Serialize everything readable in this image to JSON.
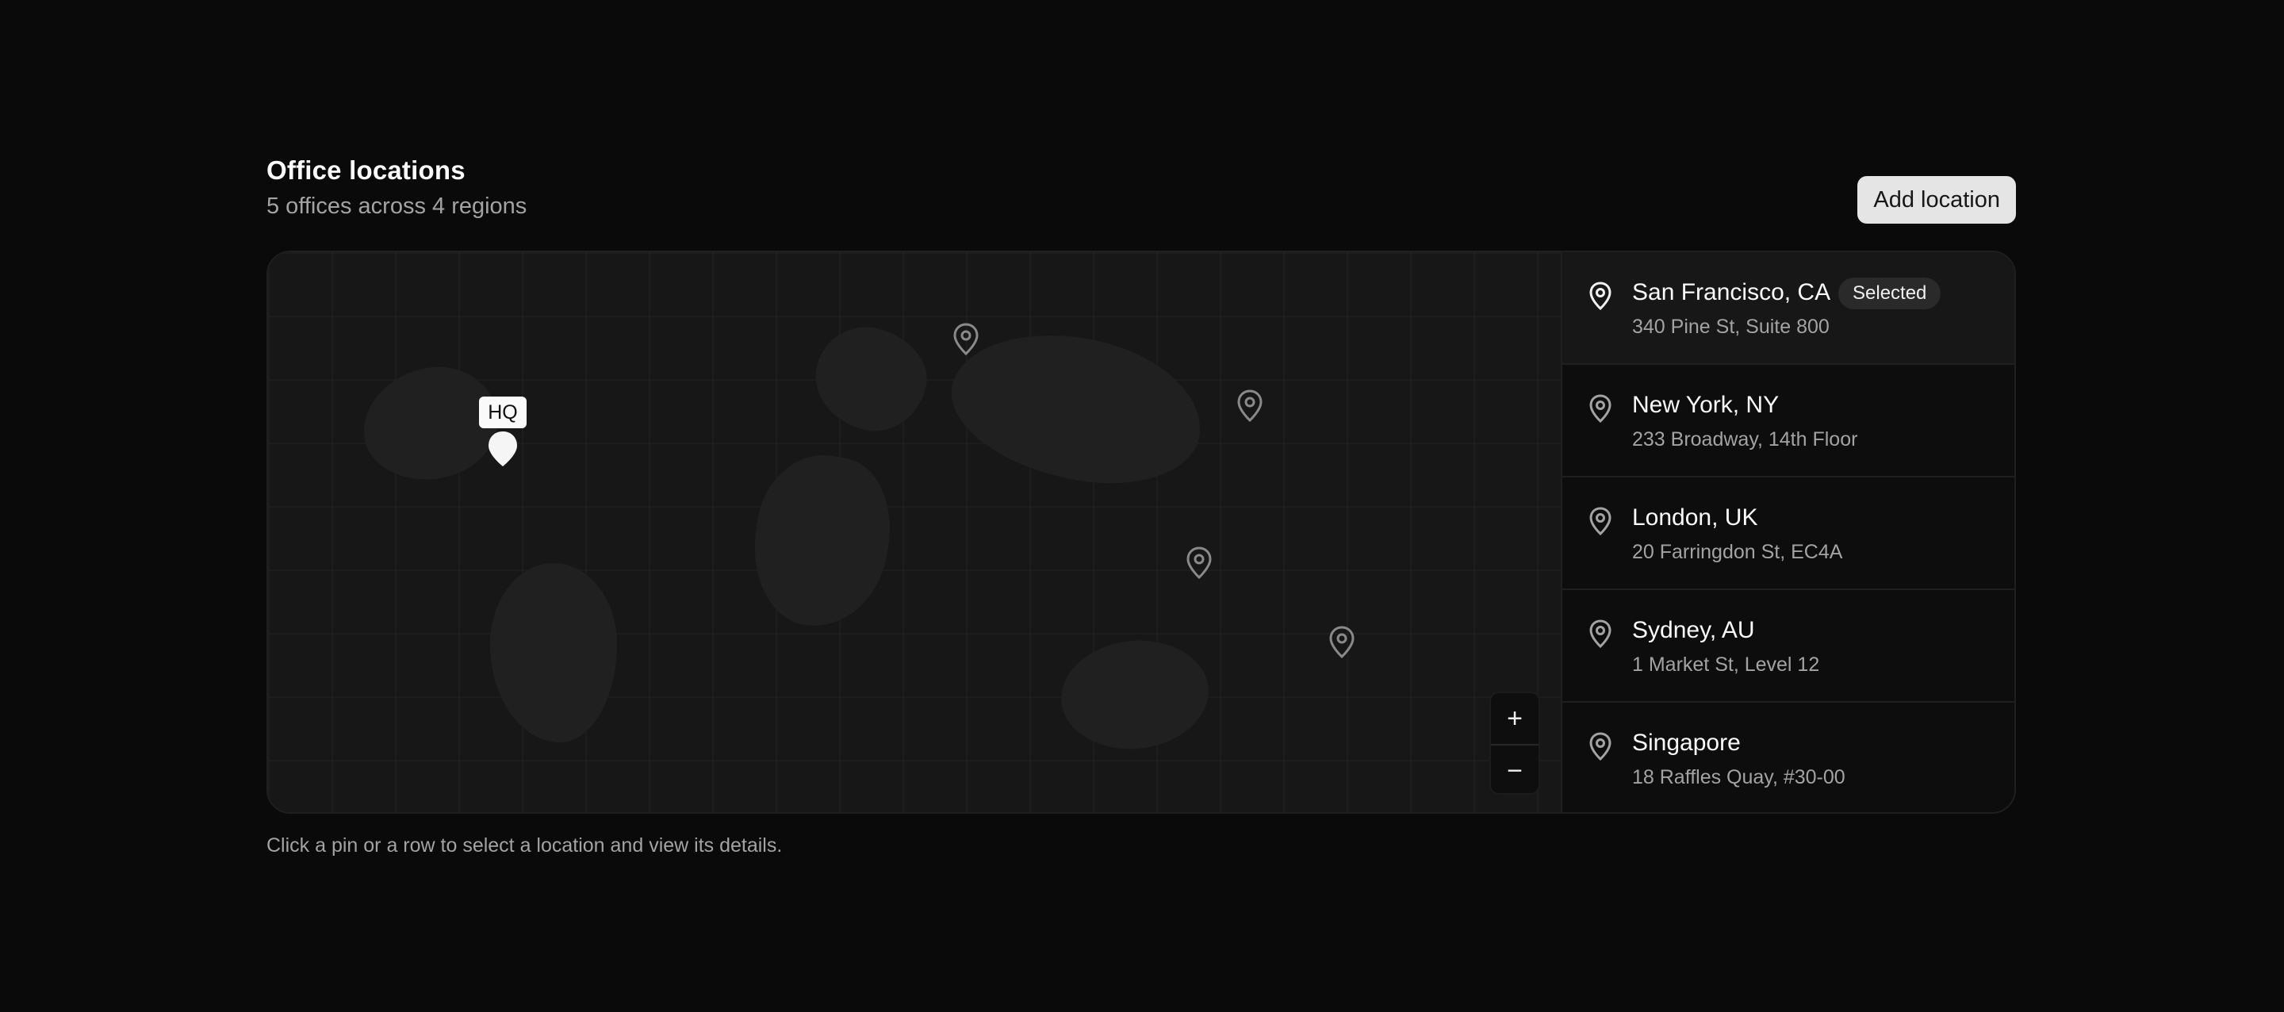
{
  "header": {
    "title": "Office locations",
    "subtitle": "5 offices across 4 regions",
    "add_button_label": "Add location"
  },
  "map": {
    "hq_label": "HQ",
    "zoom_in_label": "+",
    "zoom_out_label": "−"
  },
  "locations": [
    {
      "name": "San Francisco, CA",
      "address": "340 Pine St, Suite 800",
      "badge": "Selected"
    },
    {
      "name": "New York, NY",
      "address": "233 Broadway, 14th Floor"
    },
    {
      "name": "London, UK",
      "address": "20 Farringdon St, EC4A"
    },
    {
      "name": "Sydney, AU",
      "address": "1 Market St, Level 12"
    },
    {
      "name": "Singapore",
      "address": "18 Raffles Quay, #30-00"
    }
  ],
  "footer": {
    "hint": "Click a pin or a row to select a location and view its details."
  },
  "colors": {
    "background": "#0a0a0a",
    "map": "#171717",
    "accent": "#fafafa",
    "muted_text": "#a3a3a3"
  },
  "icons": [
    "map-pin-icon",
    "plus-icon",
    "minus-icon"
  ]
}
